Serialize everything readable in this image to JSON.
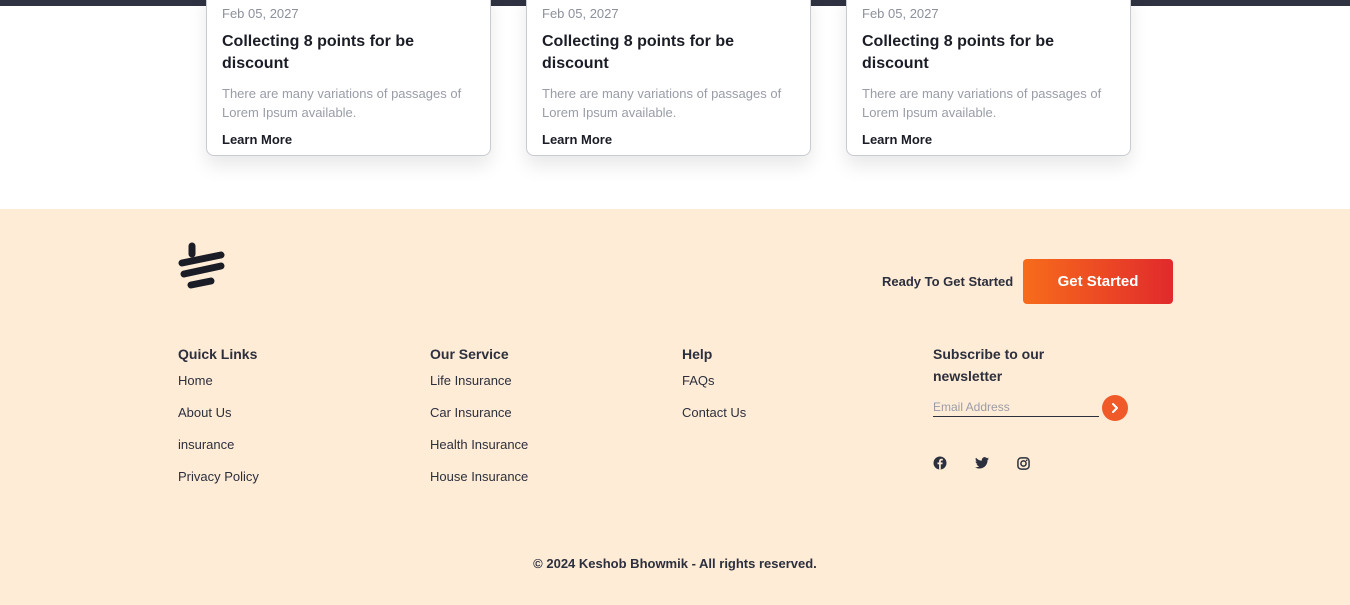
{
  "cards": [
    {
      "date": "Feb 05, 2027",
      "title": "Collecting 8 points for be discount",
      "description": "There are many variations of passages of Lorem Ipsum available.",
      "link": "Learn More"
    },
    {
      "date": "Feb 05, 2027",
      "title": "Collecting 8 points for be discount",
      "description": "There are many variations of passages of Lorem Ipsum available.",
      "link": "Learn More"
    },
    {
      "date": "Feb 05, 2027",
      "title": "Collecting 8 points for be discount",
      "description": "There are many variations of passages of Lorem Ipsum available.",
      "link": "Learn More"
    }
  ],
  "footer": {
    "logo_icon": "brand-logo-icon",
    "cta": {
      "text": "Ready To Get Started",
      "button": "Get Started"
    },
    "columns": [
      {
        "title": "Quick Links",
        "links": [
          "Home",
          "About Us",
          "insurance",
          "Privacy Policy"
        ]
      },
      {
        "title": "Our Service",
        "links": [
          "Life Insurance",
          "Car Insurance",
          "Health Insurance",
          "House Insurance"
        ]
      },
      {
        "title": "Help",
        "links": [
          "FAQs",
          "Contact Us"
        ]
      }
    ],
    "newsletter": {
      "title": "Subscribe to our newsletter",
      "placeholder": "Email Address",
      "submit_icon": "chevron-right-icon"
    },
    "social_icons": [
      "facebook-icon",
      "twitter-icon",
      "instagram-icon"
    ],
    "copyright": "© 2024 Keshob Bhowmik - All rights reserved."
  },
  "colors": {
    "footer_bg": "#feecd6",
    "accent_start": "#f76c1b",
    "accent_end": "#e12a2c",
    "text_dark": "#2c2f3d"
  }
}
